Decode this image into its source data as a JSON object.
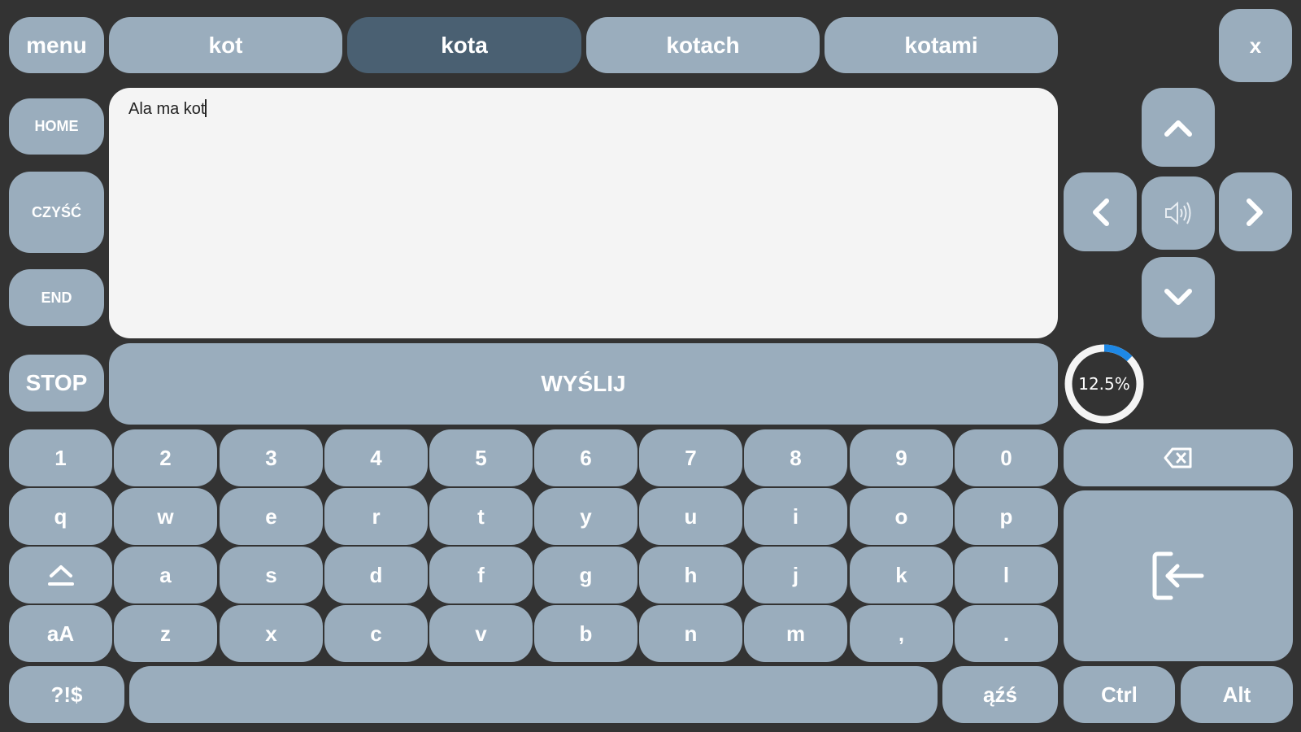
{
  "top_bar": {
    "menu_label": "menu",
    "close_label": "x",
    "suggestions": [
      {
        "label": "kot",
        "active": false
      },
      {
        "label": "kota",
        "active": true
      },
      {
        "label": "kotach",
        "active": false
      },
      {
        "label": "kotami",
        "active": false
      }
    ]
  },
  "side": {
    "home_label": "HOME",
    "clear_label": "CZYŚĆ",
    "end_label": "END",
    "stop_label": "STOP"
  },
  "text_area": {
    "value": "Ala ma kot"
  },
  "send_label": "WYŚLIJ",
  "nav": {
    "up_icon": "chevron-up-icon",
    "down_icon": "chevron-down-icon",
    "left_icon": "chevron-left-icon",
    "right_icon": "chevron-right-icon",
    "speak_icon": "speaker-icon"
  },
  "progress": {
    "label": "12.5%",
    "value": 0.125,
    "color": "#1e88e5"
  },
  "keyboard": {
    "rows": [
      [
        "1",
        "2",
        "3",
        "4",
        "5",
        "6",
        "7",
        "8",
        "9",
        "0"
      ],
      [
        "q",
        "w",
        "e",
        "r",
        "t",
        "y",
        "u",
        "i",
        "o",
        "p"
      ],
      [
        "⇧",
        "a",
        "s",
        "d",
        "f",
        "g",
        "h",
        "j",
        "k",
        "l"
      ],
      [
        "aA",
        "z",
        "x",
        "c",
        "v",
        "b",
        "n",
        "m",
        ",",
        "."
      ]
    ],
    "backspace_icon": "backspace-icon",
    "enter_icon": "enter-icon",
    "shift_icon": "shift-icon",
    "symbols_label": "?!$",
    "space_label": "",
    "diacritics_label": "ąźś",
    "ctrl_label": "Ctrl",
    "alt_label": "Alt"
  },
  "colors": {
    "key_bg": "#9aadbd",
    "active_bg": "#4a6072",
    "page_bg": "#333333"
  }
}
